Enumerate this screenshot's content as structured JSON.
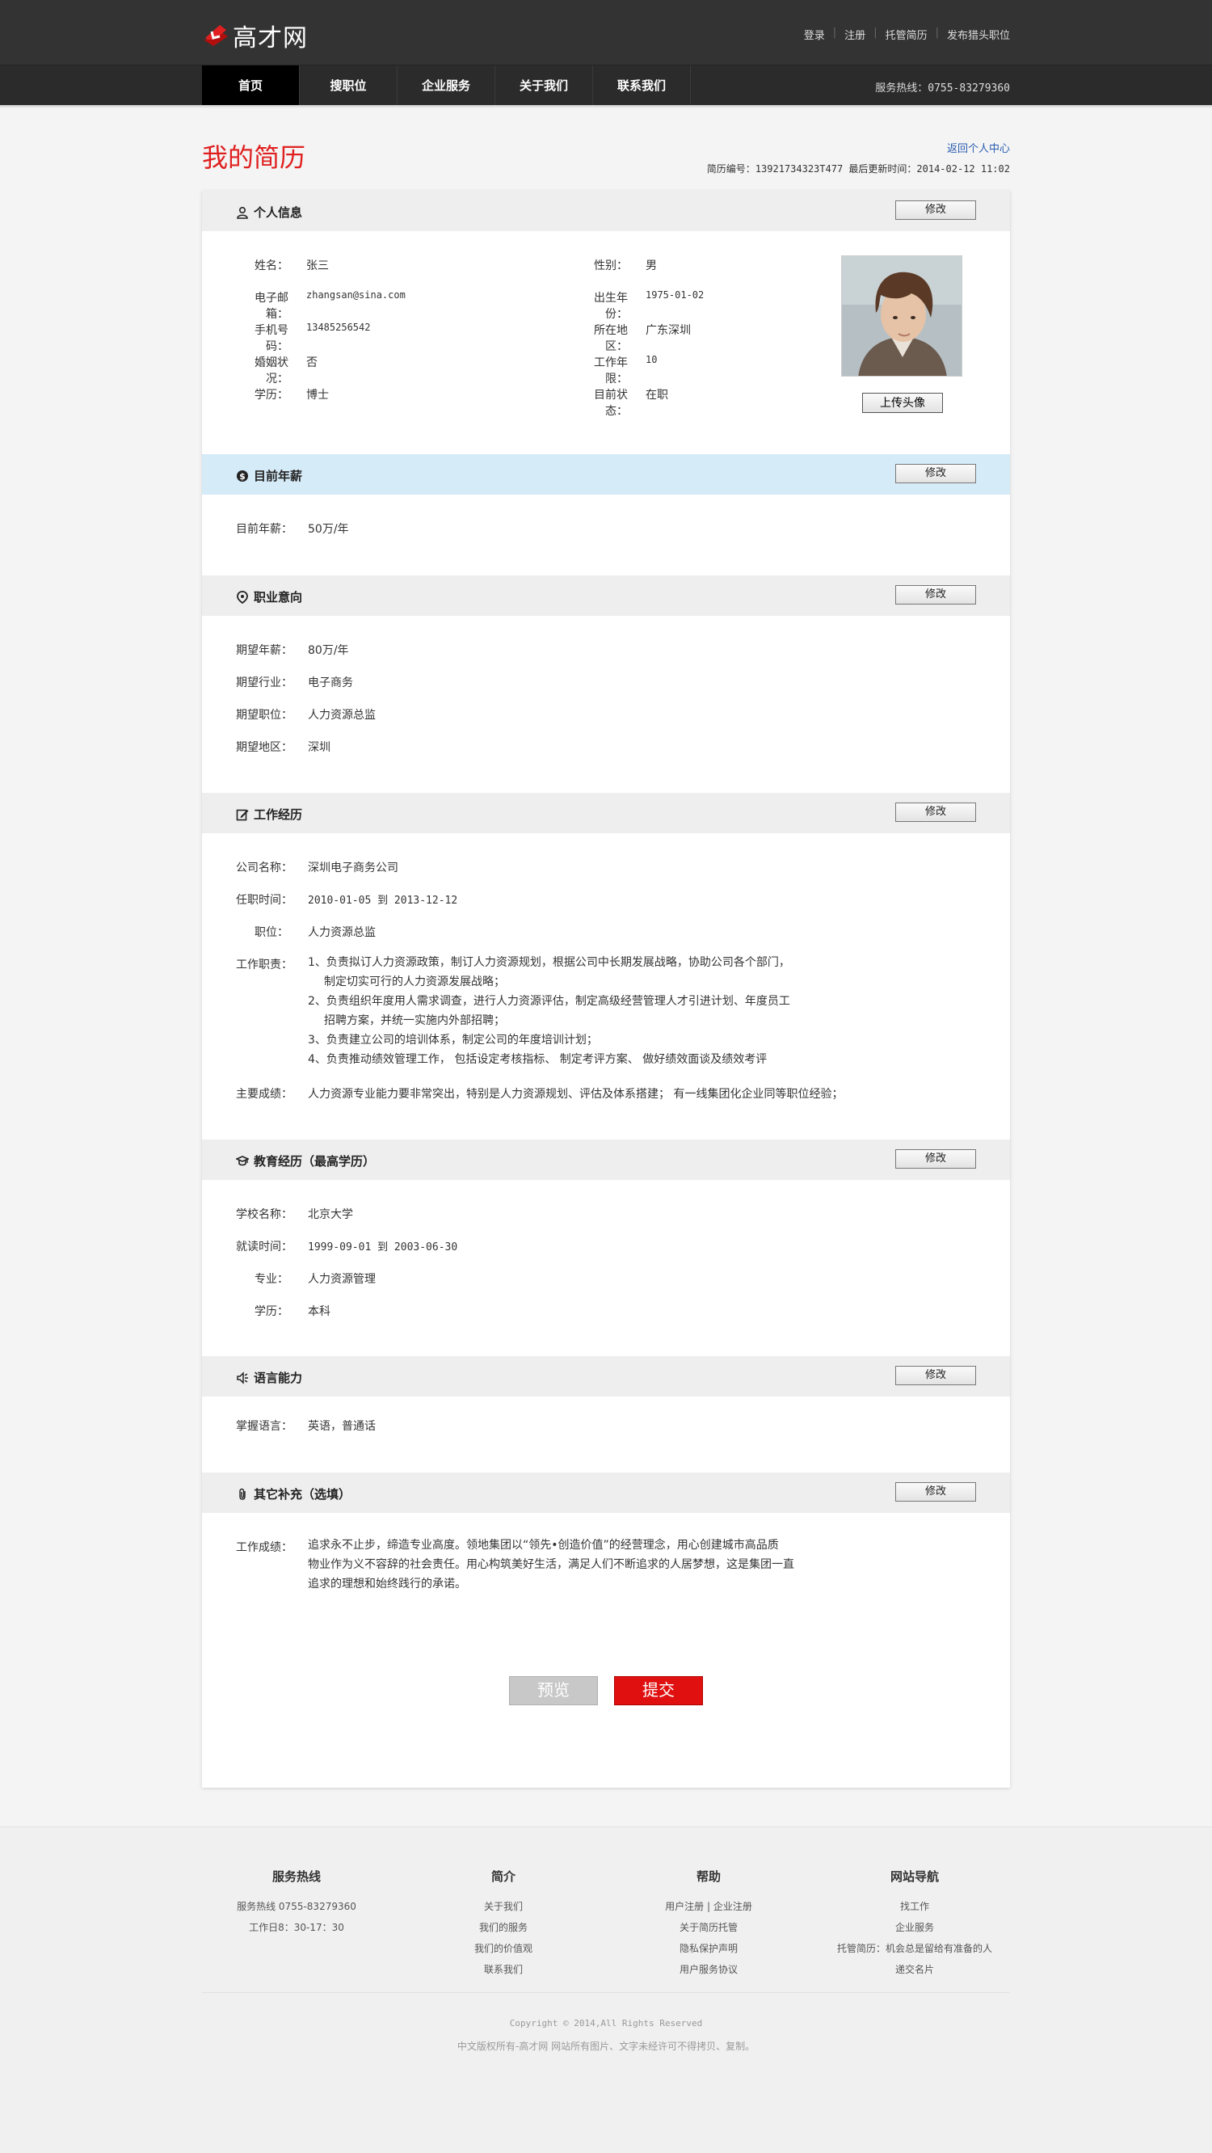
{
  "header": {
    "logo_text": "高才网",
    "links": [
      "登录",
      "注册",
      "托管简历",
      "发布猎头职位"
    ]
  },
  "nav": {
    "items": [
      "首页",
      "搜职位",
      "企业服务",
      "关于我们",
      "联系我们"
    ],
    "active_index": 0,
    "hotline": "服务热线：0755-83279360"
  },
  "page": {
    "title": "我的简历",
    "back_link": "返回个人中心",
    "resume_meta": "简历编号：13921734323T477 最后更新时间：2014-02-12 11:02"
  },
  "edit_label": "修改",
  "personal": {
    "title": "个人信息",
    "left": [
      {
        "label": "姓名：",
        "value": "张三"
      },
      {
        "label": "电子邮箱：",
        "value": "zhangsan@sina.com"
      },
      {
        "label": "手机号码：",
        "value": "13485256542"
      },
      {
        "label": "婚姻状况：",
        "value": "否"
      },
      {
        "label": "学历：",
        "value": "博士"
      }
    ],
    "right": [
      {
        "label": "性别：",
        "value": "男"
      },
      {
        "label": "出生年份：",
        "value": "1975-01-02"
      },
      {
        "label": "所在地区：",
        "value": "广东深圳"
      },
      {
        "label": "工作年限：",
        "value": "10"
      },
      {
        "label": "目前状态：",
        "value": "在职"
      }
    ],
    "upload_label": "上传头像"
  },
  "salary": {
    "title": "目前年薪",
    "label": "目前年薪：",
    "value": "50万/年"
  },
  "intention": {
    "title": "职业意向",
    "rows": [
      {
        "label": "期望年薪：",
        "value": "80万/年"
      },
      {
        "label": "期望行业：",
        "value": "电子商务"
      },
      {
        "label": "期望职位：",
        "value": "人力资源总监"
      },
      {
        "label": "期望地区：",
        "value": "深圳"
      }
    ]
  },
  "work": {
    "title": "工作经历",
    "company_label": "公司名称：",
    "company": "深圳电子商务公司",
    "period_label": "任职时间：",
    "period": "2010-01-05 到 2013-12-12",
    "position_label": "职位：",
    "position": "人力资源总监",
    "duty_label": "工作职责：",
    "duties": [
      "1、负责拟订人力资源政策，制订人力资源规划，根据公司中长期发展战略，协助公司各个部门，",
      "制定切实可行的人力资源发展战略；",
      "2、负责组织年度用人需求调查，进行人力资源评估，制定高级经营管理人才引进计划、年度员工",
      "招聘方案，并统一实施内外部招聘；",
      "3、负责建立公司的培训体系，制定公司的年度培训计划；",
      "4、负责推动绩效管理工作， 包括设定考核指标、 制定考评方案、 做好绩效面谈及绩效考评"
    ],
    "achievement_label": "主要成绩：",
    "achievement": "人力资源专业能力要非常突出，特别是人力资源规划、评估及体系搭建； 有一线集团化企业同等职位经验；"
  },
  "education": {
    "title": "教育经历（最高学历）",
    "rows": [
      {
        "label": "学校名称：",
        "value": "北京大学"
      },
      {
        "label": "就读时间：",
        "value": "1999-09-01 到 2003-06-30"
      },
      {
        "label": "专业：",
        "value": "人力资源管理"
      },
      {
        "label": "学历：",
        "value": "本科"
      }
    ]
  },
  "language": {
    "title": "语言能力",
    "label": "掌握语言：",
    "value": "英语，普通话"
  },
  "other": {
    "title": "其它补充（选填）",
    "label": "工作成绩：",
    "lines": [
      "追求永不止步，缔造专业高度。领地集团以“领先•创造价值”的经营理念，用心创建城市高品质",
      "物业作为义不容辞的社会责任。用心构筑美好生活，满足人们不断追求的人居梦想，这是集团一直",
      "追求的理想和始终践行的承诺。"
    ]
  },
  "actions": {
    "preview": "预览",
    "submit": "提交"
  },
  "footer": {
    "columns": [
      {
        "title": "服务热线",
        "links": [
          "服务热线 0755-83279360",
          "工作日8：30-17：30"
        ]
      },
      {
        "title": "简介",
        "links": [
          "关于我们",
          "我们的服务",
          "我们的价值观",
          "联系我们"
        ]
      },
      {
        "title": "帮助",
        "links": [
          "用户注册 | 企业注册",
          "关于简历托管",
          "隐私保护声明",
          "用户服务协议"
        ]
      },
      {
        "title": "网站导航",
        "links": [
          "找工作",
          "企业服务",
          "托管简历：机会总是留给有准备的人",
          "递交名片"
        ]
      }
    ],
    "copyright": "Copyright © 2014,All Rights Reserved",
    "rights": "中文版权所有-高才网 网站所有图片、文字未经许可不得拷贝、复制。"
  },
  "colors": {
    "accent_red": "#e02020",
    "header_bg": "#333333",
    "salary_head_bg": "#d6ebf8"
  }
}
